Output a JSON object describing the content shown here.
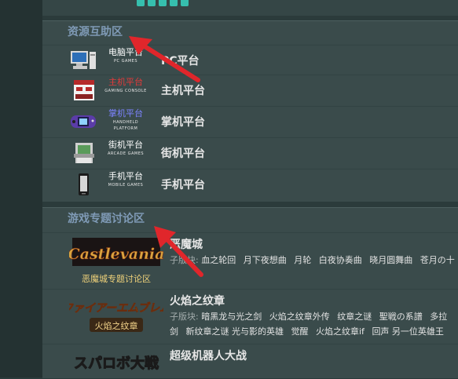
{
  "sections": [
    {
      "title": "资源互助区",
      "platforms": [
        {
          "name": "PC平台",
          "sub_cn": "电脑平台",
          "sub_en": "PC GAMES",
          "icon": "pc-icon",
          "sub_color": "#ffffff"
        },
        {
          "name": "主机平台",
          "sub_cn": "主机平台",
          "sub_en": "GAMING CONSOLE",
          "icon": "console-icon",
          "sub_color": "#e23a3a"
        },
        {
          "name": "掌机平台",
          "sub_cn": "掌机平台",
          "sub_en": "HANDHELD PLATFORM",
          "icon": "handheld-icon",
          "sub_color": "#7c83ff"
        },
        {
          "name": "街机平台",
          "sub_cn": "街机平台",
          "sub_en": "ARCADE GAMES",
          "icon": "arcade-icon",
          "sub_color": "#ffffff"
        },
        {
          "name": "手机平台",
          "sub_cn": "手机平台",
          "sub_en": "MOBILE GAMES",
          "icon": "mobile-icon",
          "sub_color": "#ffffff"
        }
      ]
    },
    {
      "title": "游戏专题讨论区",
      "games": [
        {
          "name": "恶魔城",
          "logo_text": "Castlevania",
          "logo_sub": "恶魔城专题讨论区",
          "sub_label": "子版块:",
          "subforums": [
            "血之轮回",
            "月下夜想曲",
            "月轮",
            "白夜协奏曲",
            "晓月圆舞曲",
            "苍月の十"
          ]
        },
        {
          "name": "火焰之纹章",
          "logo_text": "ファイアーエムブレム",
          "logo_sub": "火焰之纹章",
          "sub_label": "子版块:",
          "subforums": [
            "暗黑龙与光之剑",
            "火焰之纹章外传",
            "纹章之谜",
            "聖戦の系譜",
            "多拉",
            "剑",
            "新纹章之谜 光与影的英雄",
            "觉醒",
            "火焰之纹章if",
            "回声 另一位英雄王"
          ]
        },
        {
          "name": "超级机器人大战",
          "logo_text": "スパロボ大戦"
        }
      ]
    }
  ],
  "colors": {
    "section_title": "#7f9ab6",
    "arrow": "#e0262b",
    "accent": "#36bfae"
  }
}
